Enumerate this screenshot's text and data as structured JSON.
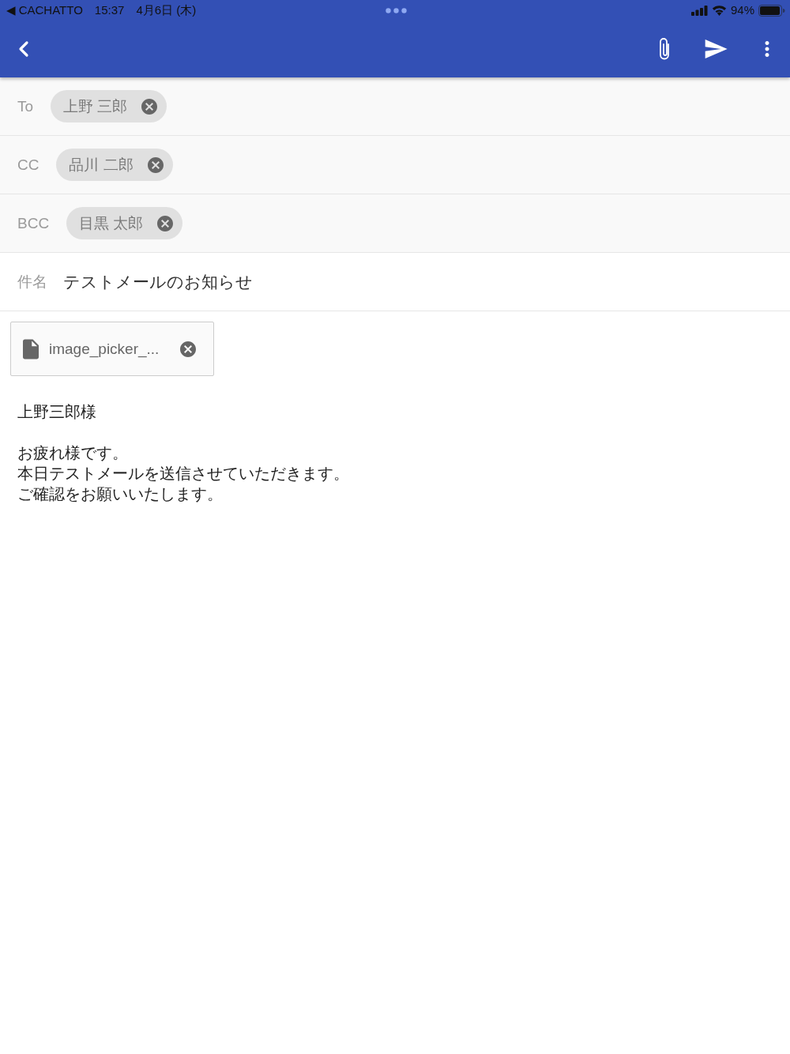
{
  "status_bar": {
    "back_label": "◀ CACHATTO",
    "time": "15:37",
    "date": "4月6日 (木)",
    "battery": "94%"
  },
  "recipients": [
    {
      "label": "To",
      "chips": [
        {
          "name": "上野 三郎"
        }
      ]
    },
    {
      "label": "CC",
      "chips": [
        {
          "name": "品川 二郎"
        }
      ]
    },
    {
      "label": "BCC",
      "chips": [
        {
          "name": "目黒 太郎"
        }
      ]
    }
  ],
  "subject": {
    "label": "件名",
    "value": "テストメールのお知らせ"
  },
  "attachments": [
    {
      "filename": "image_picker_..."
    }
  ],
  "body": {
    "paragraphs": [
      {
        "lines": [
          "上野三郎様"
        ]
      },
      {
        "lines": [
          "お疲れ様です。",
          "本日テストメールを送信させていただきます。",
          "ご確認をお願いいたします。"
        ]
      }
    ]
  }
}
